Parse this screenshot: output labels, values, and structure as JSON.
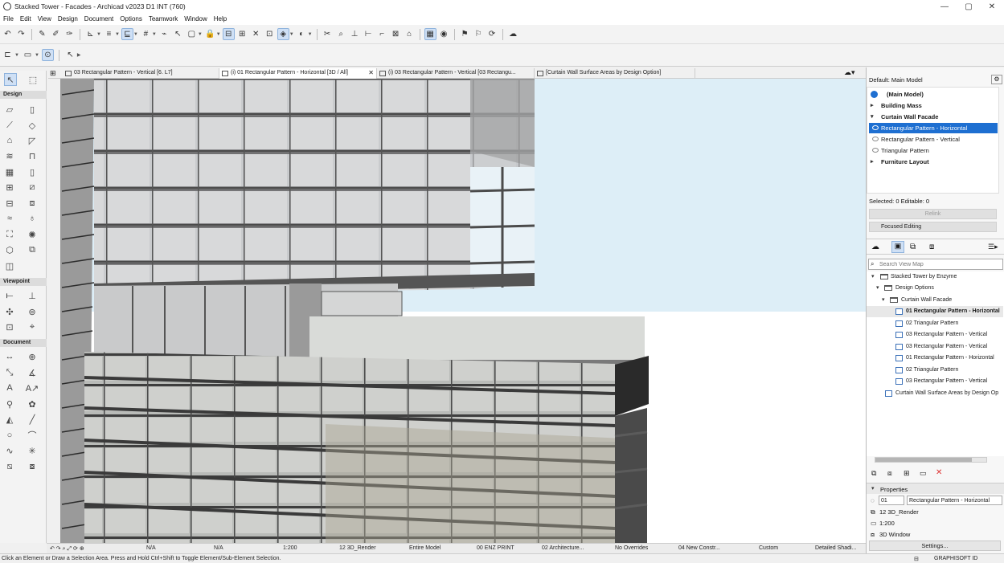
{
  "window": {
    "title": "Stacked Tower - Facades - Archicad v2023 D1 INT (760)",
    "controls": [
      "—",
      "▢",
      "✕"
    ]
  },
  "menu": [
    "File",
    "Edit",
    "View",
    "Design",
    "Document",
    "Options",
    "Teamwork",
    "Window",
    "Help"
  ],
  "toolbox": {
    "sections": [
      "Design",
      "Viewpoint",
      "Document"
    ]
  },
  "tabs": [
    {
      "label": "03 Rectangular Pattern - Vertical [6. L7]"
    },
    {
      "label": "(i) 01 Rectangular Pattern - Horizontal [3D / All]",
      "close": "✕"
    },
    {
      "label": "(i) 03 Rectangular Pattern - Vertical [03 Rectangu..."
    },
    {
      "label": "[Curtain Wall Surface Areas by Design Option]"
    }
  ],
  "design_options": {
    "header": "Default: Main Model",
    "main_model": "(Main Model)",
    "groups": [
      "Building Mass",
      "Curtain Wall Facade",
      "Furniture Layout"
    ],
    "options": [
      "Rectangular Pattern - Horizontal",
      "Rectangular Pattern - Vertical",
      "Triangular Pattern"
    ],
    "selected_info": "Selected: 0 Editable: 0",
    "relink": "Relink",
    "focused_editing": "Focused Editing"
  },
  "navigator": {
    "search_placeholder": "Search View Map",
    "root": "Stacked Tower by Enzyme",
    "folders": [
      "Design Options",
      "Curtain Wall Facade"
    ],
    "items": [
      "01 Rectangular Pattern - Horizontal",
      "02 Triangular Pattern",
      "03 Rectangular Pattern - Vertical",
      "03 Rectangular Pattern - Vertical",
      "01 Rectangular Pattern - Horizontal",
      "02 Triangular Pattern",
      "03 Rectangular Pattern - Vertical"
    ],
    "schedule": "Curtain Wall Surface Areas by Design Op"
  },
  "properties": {
    "title": "Properties",
    "id": "01",
    "name": "Rectangular Pattern - Horizontal",
    "render": "12 3D_Render",
    "scale": "1:200",
    "window": "3D Window",
    "settings": "Settings..."
  },
  "status": {
    "na1": "N/A",
    "na2": "N/A",
    "scale": "1:200",
    "layer_combo": "12 3D_Render",
    "model": "Entire Model",
    "pen": "00 ENZ PRINT",
    "mvo": "02 Architecture...",
    "overrides": "No Overrides",
    "reno": "04 New Constr...",
    "custom": "Custom",
    "detail": "Detailed Shadi..."
  },
  "hint": "Click an Element or Draw a Selection Area. Press and Hold Ctrl+Shift to Toggle Element/Sub-Element Selection.",
  "brand": "GRAPHISOFT ID",
  "colors": {
    "accent": "#1e6fd1",
    "sky": "#ddeef7"
  }
}
